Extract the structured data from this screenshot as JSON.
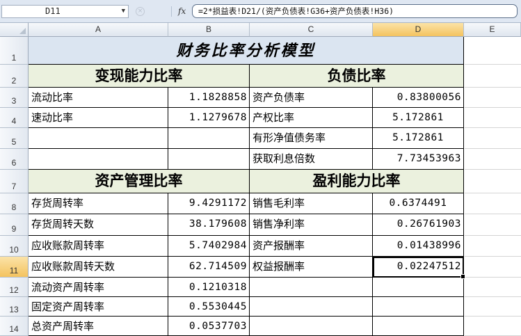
{
  "formula_bar": {
    "name_box": "D11",
    "fx_label": "fx",
    "cancel_symbol": "×",
    "formula": "=2*损益表!D21/(资产负债表!G36+资产负债表!H36)"
  },
  "columns": [
    "A",
    "B",
    "C",
    "D",
    "E"
  ],
  "rows": [
    "1",
    "2",
    "3",
    "4",
    "5",
    "6",
    "7",
    "8",
    "9",
    "10",
    "11",
    "12",
    "13",
    "14"
  ],
  "title": "财务比率分析模型",
  "sections": {
    "liquidity": "变现能力比率",
    "debt": "负债比率",
    "asset_mgmt": "资产管理比率",
    "profit": "盈利能力比率"
  },
  "cells": {
    "A3": "流动比率",
    "B3": "1.1828858",
    "C3": "资产负债率",
    "D3": "0.83800056",
    "A4": "速动比率",
    "B4": "1.1279678",
    "C4": "产权比率",
    "D4": "5.172861",
    "A5": "",
    "B5": "",
    "C5": "有形净值债务率",
    "D5": "5.172861",
    "A6": "",
    "B6": "",
    "C6": "获取利息倍数",
    "D6": "7.73453963",
    "A8": "存货周转率",
    "B8": "9.4291172",
    "C8": "销售毛利率",
    "D8": "0.6374491",
    "A9": "存货周转天数",
    "B9": "38.179608",
    "C9": "销售净利率",
    "D9": "0.26761903",
    "A10": "应收账款周转率",
    "B10": "5.7402984",
    "C10": "资产报酬率",
    "D10": "0.01438996",
    "A11": "应收账款周转天数",
    "B11": "62.714509",
    "C11": "权益报酬率",
    "D11": "0.02247512",
    "A12": "流动资产周转率",
    "B12": "0.1210318",
    "C12": "",
    "D12": "",
    "A13": "固定资产周转率",
    "B13": "0.5530445",
    "C13": "",
    "D13": "",
    "A14": "总资产周转率",
    "B14": "0.0537703",
    "C14": "",
    "D14": ""
  },
  "selection": {
    "cell": "D11",
    "column": "D",
    "row": "11"
  }
}
